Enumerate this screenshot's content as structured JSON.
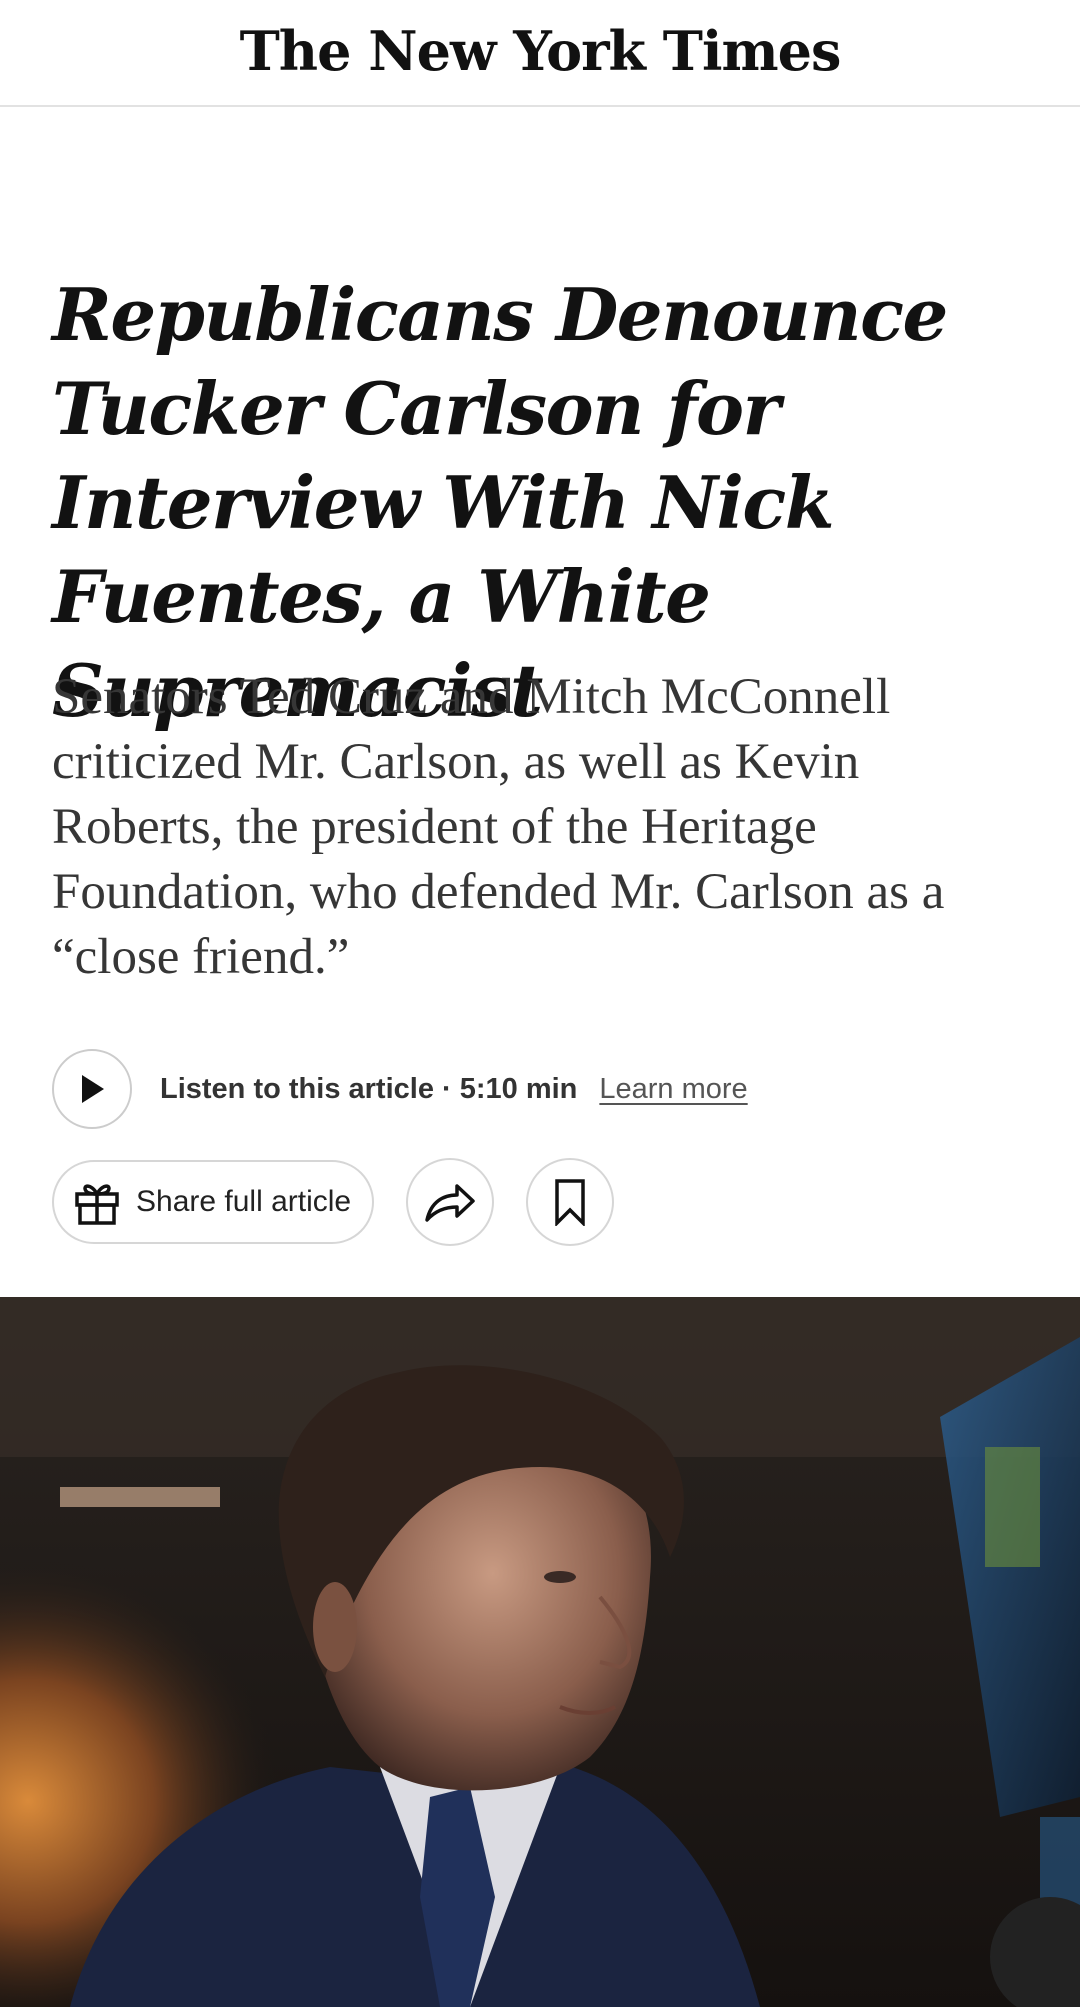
{
  "masthead": {
    "title": "The New York Times"
  },
  "article": {
    "headline": "Republicans Denounce Tucker Carlson for Interview With Nick Fuentes, a White Supremacist",
    "summary": "Senators Ted Cruz and Mitch McConnell criticized Mr. Carlson, as well as Kevin Roberts, the president of the Heritage Foundation, who defended Mr. Carlson as a “close friend.”"
  },
  "audio": {
    "listen_label": "Listen to this article · 5:10 min",
    "learn_more_label": "Learn more",
    "play_icon": "play-icon"
  },
  "actions": {
    "share_full_label": "Share full article",
    "gift_icon": "gift-icon",
    "share_icon": "share-arrow-icon",
    "save_icon": "bookmark-icon"
  },
  "colors": {
    "headline": "#121212",
    "summary": "#363636",
    "divider": "#e2e2e2",
    "button_border": "#d6d6d6"
  }
}
